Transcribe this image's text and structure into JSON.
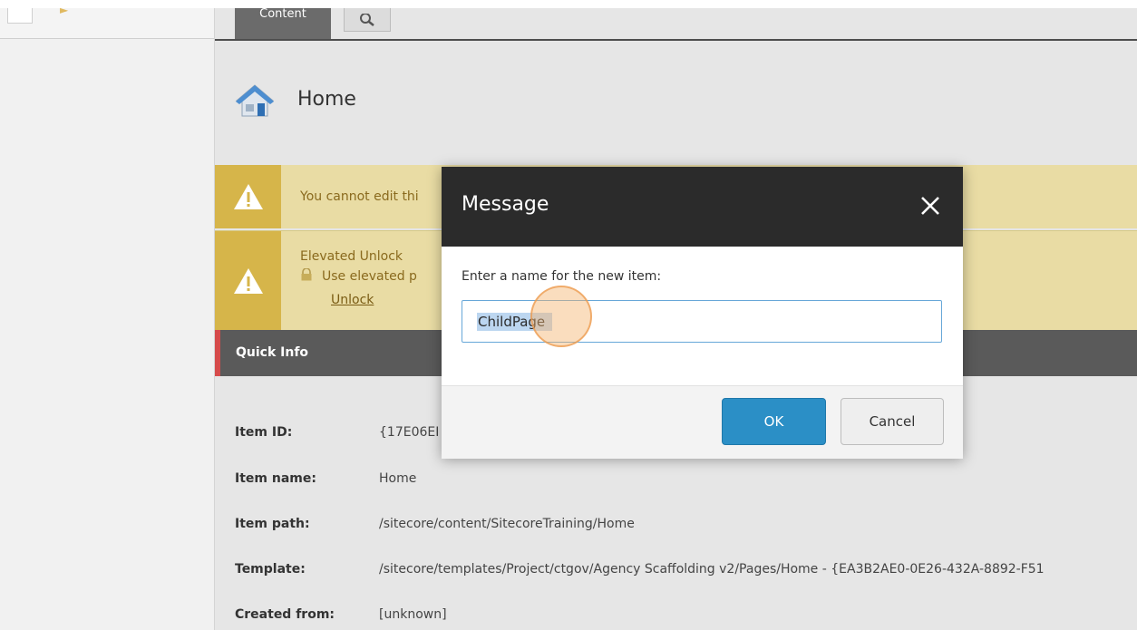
{
  "tabs": {
    "content_label": "Content"
  },
  "item": {
    "title": "Home"
  },
  "warnings": {
    "cannot_edit_text": "You cannot edit thi",
    "elevated_title": "Elevated Unlock",
    "elevated_line": "Use elevated p",
    "unlock_label": "Unlock"
  },
  "quick_info": {
    "title": "Quick Info",
    "rows": [
      {
        "label": "Item ID:",
        "value": "{17E06EI"
      },
      {
        "label": "Item name:",
        "value": "Home"
      },
      {
        "label": "Item path:",
        "value": "/sitecore/content/SitecoreTraining/Home"
      },
      {
        "label": "Template:",
        "value": "/sitecore/templates/Project/ctgov/Agency Scaffolding v2/Pages/Home - {EA3B2AE0-0E26-432A-8892-F51"
      },
      {
        "label": "Created from:",
        "value": "[unknown]"
      }
    ]
  },
  "dialog": {
    "title": "Message",
    "prompt": "Enter a name for the new item:",
    "input_value": "ChildPage",
    "ok_label": "OK",
    "cancel_label": "Cancel"
  },
  "colors": {
    "accent": "#2b8fc6",
    "warning_bg": "#e9dca4",
    "warning_icon_bg": "#d6b54a",
    "quick_info_bar": "#5a5a5a",
    "dialog_header": "#2b2b2b"
  }
}
